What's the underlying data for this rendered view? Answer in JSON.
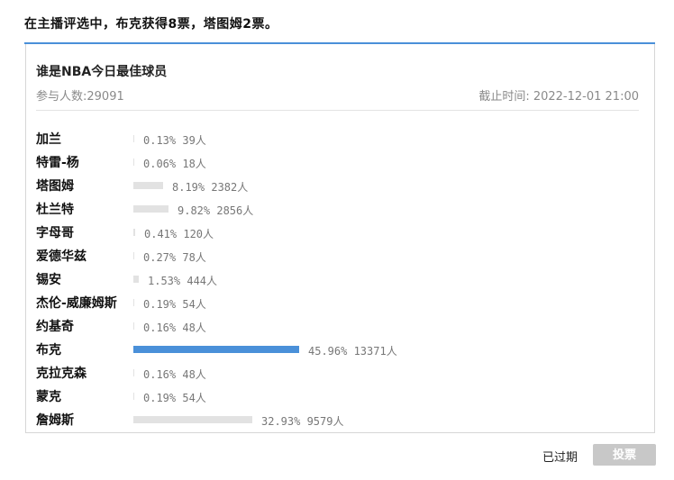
{
  "headline": "在主播评选中，布克获得8票，塔图姆2票。",
  "poll": {
    "title": "谁是NBA今日最佳球员",
    "participants": "参与人数:29091",
    "deadline": "截止时间: 2022-12-01 21:00",
    "options": [
      {
        "name": "加兰",
        "percent": 0.13,
        "stats": "0.13%  39人"
      },
      {
        "name": "特雷-杨",
        "percent": 0.06,
        "stats": "0.06%  18人"
      },
      {
        "name": "塔图姆",
        "percent": 8.19,
        "stats": "8.19%  2382人"
      },
      {
        "name": "杜兰特",
        "percent": 9.82,
        "stats": "9.82%  2856人"
      },
      {
        "name": "字母哥",
        "percent": 0.41,
        "stats": "0.41%  120人"
      },
      {
        "name": "爱德华兹",
        "percent": 0.27,
        "stats": "0.27%  78人"
      },
      {
        "name": "锡安",
        "percent": 1.53,
        "stats": "1.53%  444人"
      },
      {
        "name": "杰伦-威廉姆斯",
        "percent": 0.19,
        "stats": "0.19%  54人"
      },
      {
        "name": "约基奇",
        "percent": 0.16,
        "stats": "0.16%  48人"
      },
      {
        "name": "布克",
        "percent": 45.96,
        "stats": "45.96%  13371人",
        "leader": true
      },
      {
        "name": "克拉克森",
        "percent": 0.16,
        "stats": "0.16%  48人"
      },
      {
        "name": "蒙克",
        "percent": 0.19,
        "stats": "0.19%  54人"
      },
      {
        "name": "詹姆斯",
        "percent": 32.93,
        "stats": "32.93%  9579人"
      }
    ],
    "colors": {
      "leader_bar": "#4a90d9",
      "bar": "#e2e2e2",
      "accent_rule": "#4a90d9"
    }
  },
  "footer": {
    "status": "已过期",
    "vote_label": "投票"
  }
}
